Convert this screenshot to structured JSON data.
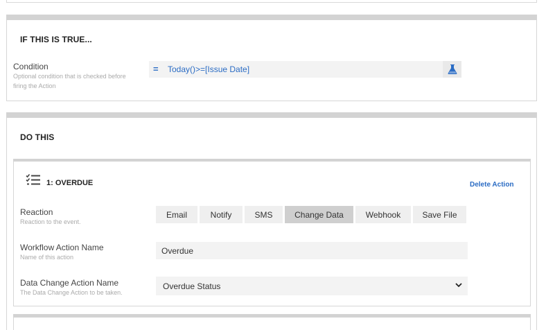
{
  "if_section": {
    "title": "IF THIS IS TRUE...",
    "condition_label": "Condition",
    "condition_help_1": "Optional condition that is checked before",
    "condition_help_2": "firing the Action",
    "condition_eq": "=",
    "condition_value": "Today()>=[Issue Date]",
    "test_icon": "flask-icon"
  },
  "do_section": {
    "title": "DO THIS",
    "action": {
      "icon": "checklist-icon",
      "title": "1: OVERDUE",
      "delete_label": "Delete Action",
      "reaction_label": "Reaction",
      "reaction_help": "Reaction to the event.",
      "reactions": [
        "Email",
        "Notify",
        "SMS",
        "Change Data",
        "Webhook",
        "Save File"
      ],
      "active_reaction": "Change Data",
      "name_label": "Workflow Action Name",
      "name_help": "Name of this action",
      "name_value": "Overdue",
      "data_change_label": "Data Change Action Name",
      "data_change_help": "The Data Change Action to be taken.",
      "data_change_value": "Overdue Status"
    }
  },
  "colors": {
    "link": "#2b6cc4",
    "section_bar": "#d3d3d3",
    "active_reaction": "#cfcfcf"
  }
}
